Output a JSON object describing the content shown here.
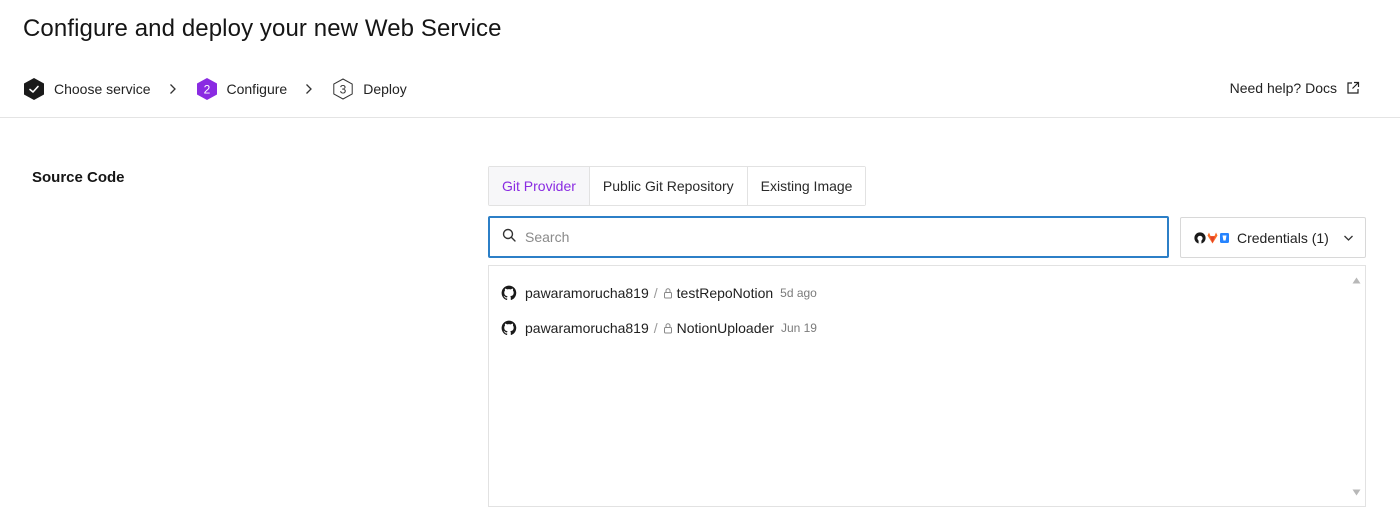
{
  "page": {
    "title": "Configure and deploy your new Web Service"
  },
  "stepper": {
    "steps": [
      {
        "number": "",
        "label": "Choose service",
        "state": "done"
      },
      {
        "number": "2",
        "label": "Configure",
        "state": "current"
      },
      {
        "number": "3",
        "label": "Deploy",
        "state": "upcoming"
      }
    ],
    "separator": ">"
  },
  "help": {
    "label": "Need help? Docs"
  },
  "source": {
    "label": "Source Code",
    "tabs": [
      {
        "label": "Git Provider",
        "active": true
      },
      {
        "label": "Public Git Repository",
        "active": false
      },
      {
        "label": "Existing Image",
        "active": false
      }
    ],
    "search": {
      "placeholder": "Search",
      "value": ""
    },
    "credentials": {
      "label": "Credentials (1)"
    },
    "repos": [
      {
        "owner": "pawaramorucha819",
        "name": "testRepoNotion",
        "updated": "5d ago"
      },
      {
        "owner": "pawaramorucha819",
        "name": "NotionUploader",
        "updated": "Jun 19"
      }
    ]
  },
  "colors": {
    "accent": "#8a2be2",
    "focus": "#2c7fc7",
    "done": "#1a1a1a"
  }
}
